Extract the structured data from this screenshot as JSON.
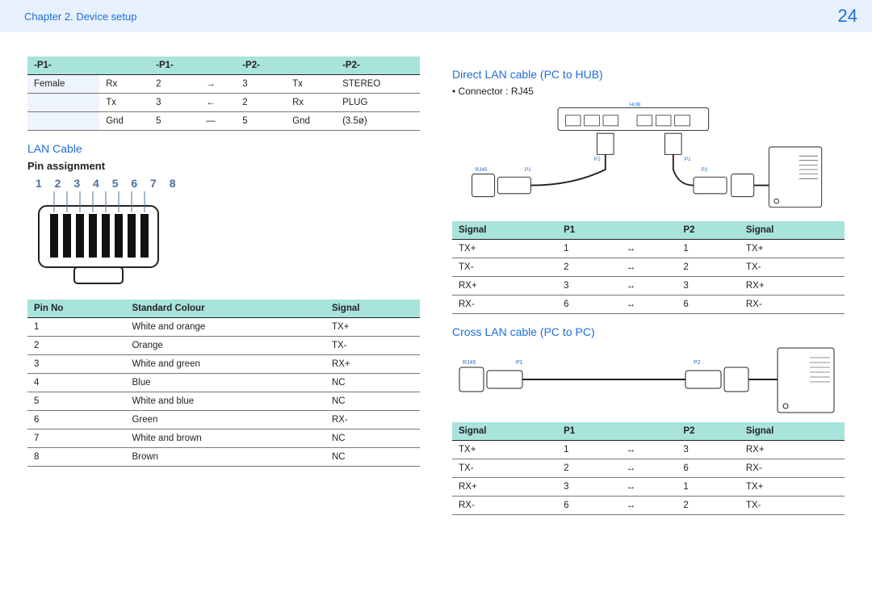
{
  "header": {
    "chapter": "Chapter 2. Device setup",
    "page": "24"
  },
  "topTable": {
    "headers": [
      "-P1-",
      "",
      "-P1-",
      "",
      "-P2-",
      "",
      "-P2-"
    ],
    "rows": [
      [
        "Female",
        "Rx",
        "2",
        "→",
        "3",
        "Tx",
        "STEREO"
      ],
      [
        "",
        "Tx",
        "3",
        "←",
        "2",
        "Rx",
        "PLUG"
      ],
      [
        "",
        "Gnd",
        "5",
        "—",
        "5",
        "Gnd",
        "(3.5ø)"
      ]
    ]
  },
  "lanSection": {
    "title": "LAN Cable",
    "subtitle": "Pin assignment",
    "pins": "1 2 3 4 5 6 7 8"
  },
  "pinTable": {
    "headers": [
      "Pin No",
      "Standard Colour",
      "Signal"
    ],
    "rows": [
      [
        "1",
        "White and orange",
        "TX+"
      ],
      [
        "2",
        "Orange",
        "TX-"
      ],
      [
        "3",
        "White and green",
        "RX+"
      ],
      [
        "4",
        "Blue",
        "NC"
      ],
      [
        "5",
        "White and blue",
        "NC"
      ],
      [
        "6",
        "Green",
        "RX-"
      ],
      [
        "7",
        "White and brown",
        "NC"
      ],
      [
        "8",
        "Brown",
        "NC"
      ]
    ]
  },
  "direct": {
    "title": "Direct LAN cable (PC to HUB)",
    "note": "Connector : RJ45",
    "labels": {
      "hub": "HUB",
      "rj45": "RJ45",
      "p1": "P1",
      "p2": "P2"
    },
    "table": {
      "headers": [
        "Signal",
        "P1",
        "",
        "P2",
        "Signal"
      ],
      "rows": [
        [
          "TX+",
          "1",
          "↔",
          "1",
          "TX+"
        ],
        [
          "TX-",
          "2",
          "↔",
          "2",
          "TX-"
        ],
        [
          "RX+",
          "3",
          "↔",
          "3",
          "RX+"
        ],
        [
          "RX-",
          "6",
          "↔",
          "6",
          "RX-"
        ]
      ]
    }
  },
  "cross": {
    "title": "Cross LAN cable (PC to PC)",
    "labels": {
      "rj45": "RJ45",
      "p1": "P1",
      "p2": "P2"
    },
    "table": {
      "headers": [
        "Signal",
        "P1",
        "",
        "P2",
        "Signal"
      ],
      "rows": [
        [
          "TX+",
          "1",
          "↔",
          "3",
          "RX+"
        ],
        [
          "TX-",
          "2",
          "↔",
          "6",
          "RX-"
        ],
        [
          "RX+",
          "3",
          "↔",
          "1",
          "TX+"
        ],
        [
          "RX-",
          "6",
          "↔",
          "2",
          "TX-"
        ]
      ]
    }
  }
}
